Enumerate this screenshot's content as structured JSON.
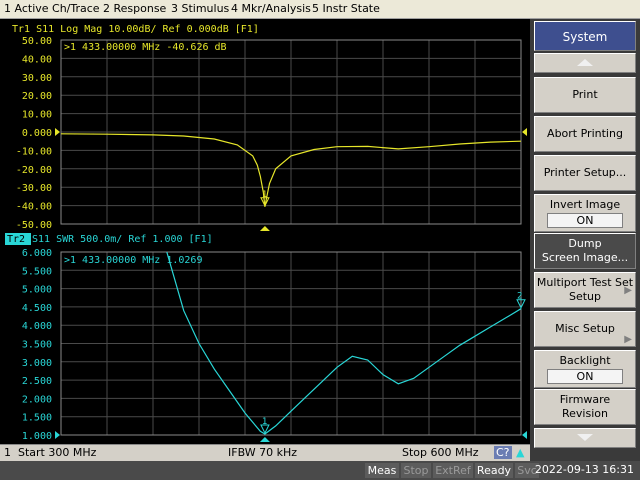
{
  "menu": [
    "1 Active Ch/Trace",
    "2 Response",
    "3 Stimulus",
    "4 Mkr/Analysis",
    "5 Instr State"
  ],
  "colors": {
    "trace1": "#e6e62a",
    "trace2": "#29d6d6",
    "grid": "#4a4a4a",
    "background": "#000000"
  },
  "trace1": {
    "id": "Tr1",
    "header": "Tr1  S11  Log Mag 10.00dB/ Ref 0.000dB [F1]",
    "marker_readout": ">1  433.00000 MHz -40.626 dB",
    "marker_label": "1",
    "end_marker_label": "1",
    "y_ticks": [
      "50.00",
      "40.00",
      "30.00",
      "20.00",
      "10.00",
      "0.000",
      "-10.00",
      "-20.00",
      "-30.00",
      "-40.00",
      "-50.00"
    ]
  },
  "trace2": {
    "id": "Tr2",
    "header": " S11  SWR 500.0m/ Ref 1.000 [F1]",
    "marker_readout": ">1  433.00000 MHz  1.0269",
    "marker_label": "1",
    "end_marker_label": "2",
    "y_ticks": [
      "6.000",
      "5.500",
      "5.000",
      "4.500",
      "4.000",
      "3.500",
      "3.000",
      "2.500",
      "2.000",
      "1.500",
      "1.000"
    ]
  },
  "chart_data": [
    {
      "type": "line",
      "title": "Tr1 S11 Log Mag 10.00dB/ Ref 0.000dB [F1]",
      "xlabel": "",
      "ylabel": "",
      "xlim": [
        300,
        600
      ],
      "ylim": [
        -50,
        50
      ],
      "grid": true,
      "series": [
        {
          "name": "S11 Log Mag",
          "x": [
            300,
            330,
            360,
            380,
            400,
            415,
            425,
            428,
            430,
            432,
            433,
            434,
            436,
            440,
            450,
            465,
            480,
            500,
            520,
            540,
            560,
            580,
            600
          ],
          "y": [
            -1.0,
            -1.2,
            -1.6,
            -2.2,
            -3.8,
            -7.0,
            -13.0,
            -18.0,
            -24.0,
            -33.0,
            -40.626,
            -36.0,
            -28.0,
            -20.0,
            -13.0,
            -9.5,
            -8.0,
            -7.8,
            -9.2,
            -8.0,
            -6.5,
            -5.5,
            -5.0
          ]
        }
      ],
      "markers": [
        {
          "label": "1",
          "x": 433,
          "y": -40.626
        }
      ]
    },
    {
      "type": "line",
      "title": "Tr2 S11 SWR 500.0m/ Ref 1.000 [F1]",
      "xlabel": "",
      "ylabel": "",
      "xlim": [
        300,
        600
      ],
      "ylim": [
        1.0,
        6.0
      ],
      "grid": true,
      "series": [
        {
          "name": "S11 SWR",
          "x": [
            369,
            380,
            390,
            400,
            410,
            420,
            430,
            433,
            440,
            450,
            460,
            470,
            480,
            490,
            500,
            510,
            520,
            530,
            540,
            550,
            560,
            570,
            580,
            590,
            600
          ],
          "y": [
            6.0,
            4.4,
            3.5,
            2.8,
            2.2,
            1.6,
            1.1,
            1.0269,
            1.25,
            1.65,
            2.05,
            2.45,
            2.85,
            3.15,
            3.05,
            2.65,
            2.4,
            2.55,
            2.85,
            3.15,
            3.45,
            3.7,
            3.95,
            4.2,
            4.45
          ]
        }
      ],
      "markers": [
        {
          "label": "1",
          "x": 433,
          "y": 1.0269
        },
        {
          "label": "2",
          "x": 600,
          "y": 4.45
        }
      ]
    }
  ],
  "status": {
    "channel": "1",
    "start": "Start 300 MHz",
    "ifbw": "IFBW 70 kHz",
    "stop": "Stop 600 MHz",
    "c2": "C?",
    "up_icon": "up-arrow-icon"
  },
  "indicators": [
    {
      "label": "Meas",
      "active": true
    },
    {
      "label": "Stop",
      "active": false
    },
    {
      "label": "ExtRef",
      "active": false
    },
    {
      "label": "Ready",
      "active": true
    },
    {
      "label": "Svc",
      "active": false
    }
  ],
  "datetime": "2022-09-13 16:31",
  "softkeys": {
    "title": "System",
    "print": "Print",
    "abort": "Abort Printing",
    "printer_setup": "Printer Setup...",
    "invert_image": "Invert Image",
    "invert_image_value": "ON",
    "dump_1": "Dump",
    "dump_2": "Screen Image...",
    "multiport_1": "Multiport Test Set",
    "multiport_2": "Setup",
    "misc_setup": "Misc Setup",
    "backlight": "Backlight",
    "backlight_value": "ON",
    "firmware_1": "Firmware",
    "firmware_2": "Revision"
  }
}
